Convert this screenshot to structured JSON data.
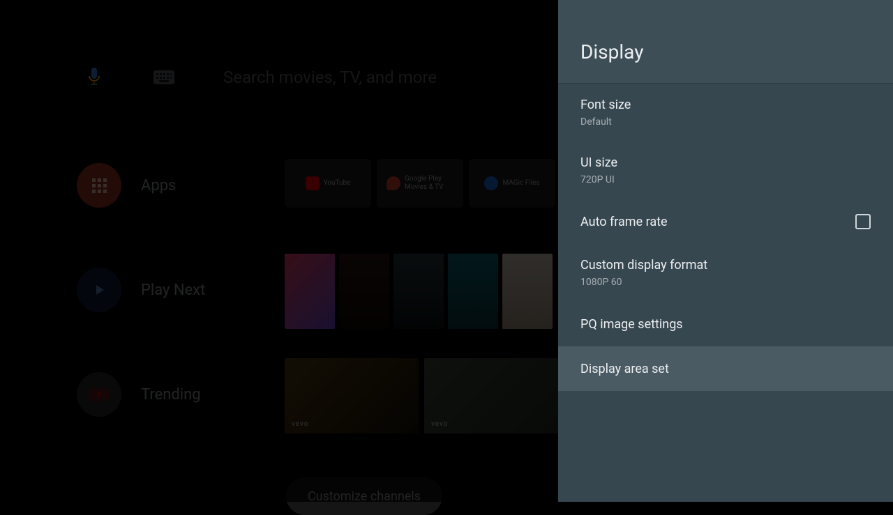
{
  "search": {
    "placeholder": "Search movies, TV, and more"
  },
  "rows": {
    "apps": {
      "label": "Apps"
    },
    "play_next": {
      "label": "Play Next"
    },
    "trending": {
      "label": "Trending"
    }
  },
  "apps": [
    {
      "name": "YouTube"
    },
    {
      "name": "Google Play Movies & TV"
    },
    {
      "name": "MAGic Files"
    }
  ],
  "trending_tag": "vevo",
  "customize": "Customize channels",
  "panel": {
    "title": "Display",
    "items": [
      {
        "label": "Font size",
        "sub": "Default"
      },
      {
        "label": "UI size",
        "sub": "720P UI"
      },
      {
        "label": "Auto frame rate",
        "checkbox": true,
        "checked": false
      },
      {
        "label": "Custom display format",
        "sub": "1080P 60"
      },
      {
        "label": "PQ image settings"
      },
      {
        "label": "Display area set",
        "selected": true
      }
    ]
  }
}
